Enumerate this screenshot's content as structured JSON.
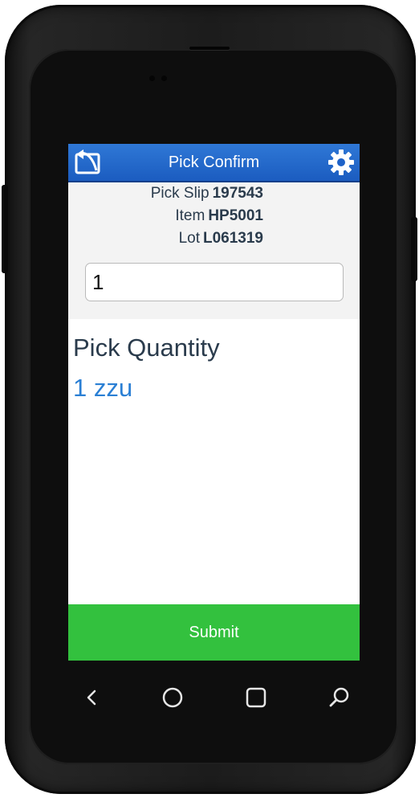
{
  "header": {
    "title": "Pick Confirm",
    "back_icon": "back-icon",
    "settings_icon": "gear-icon"
  },
  "info": {
    "pick_slip_label": "Pick Slip",
    "pick_slip_value": "197543",
    "item_label": "Item",
    "item_value": "HP5001",
    "lot_label": "Lot",
    "lot_value": "L061319"
  },
  "input": {
    "value": "1"
  },
  "result": {
    "label": "Pick Quantity",
    "value": "1 zzu"
  },
  "footer": {
    "submit_label": "Submit"
  },
  "navbar": {
    "items": [
      "back-icon",
      "home-icon",
      "recents-icon",
      "search-icon"
    ]
  },
  "colors": {
    "header_blue": "#1b5cc0",
    "submit_green": "#33c13e",
    "value_blue": "#2a7fd4",
    "text_dark": "#2a3b4c"
  }
}
